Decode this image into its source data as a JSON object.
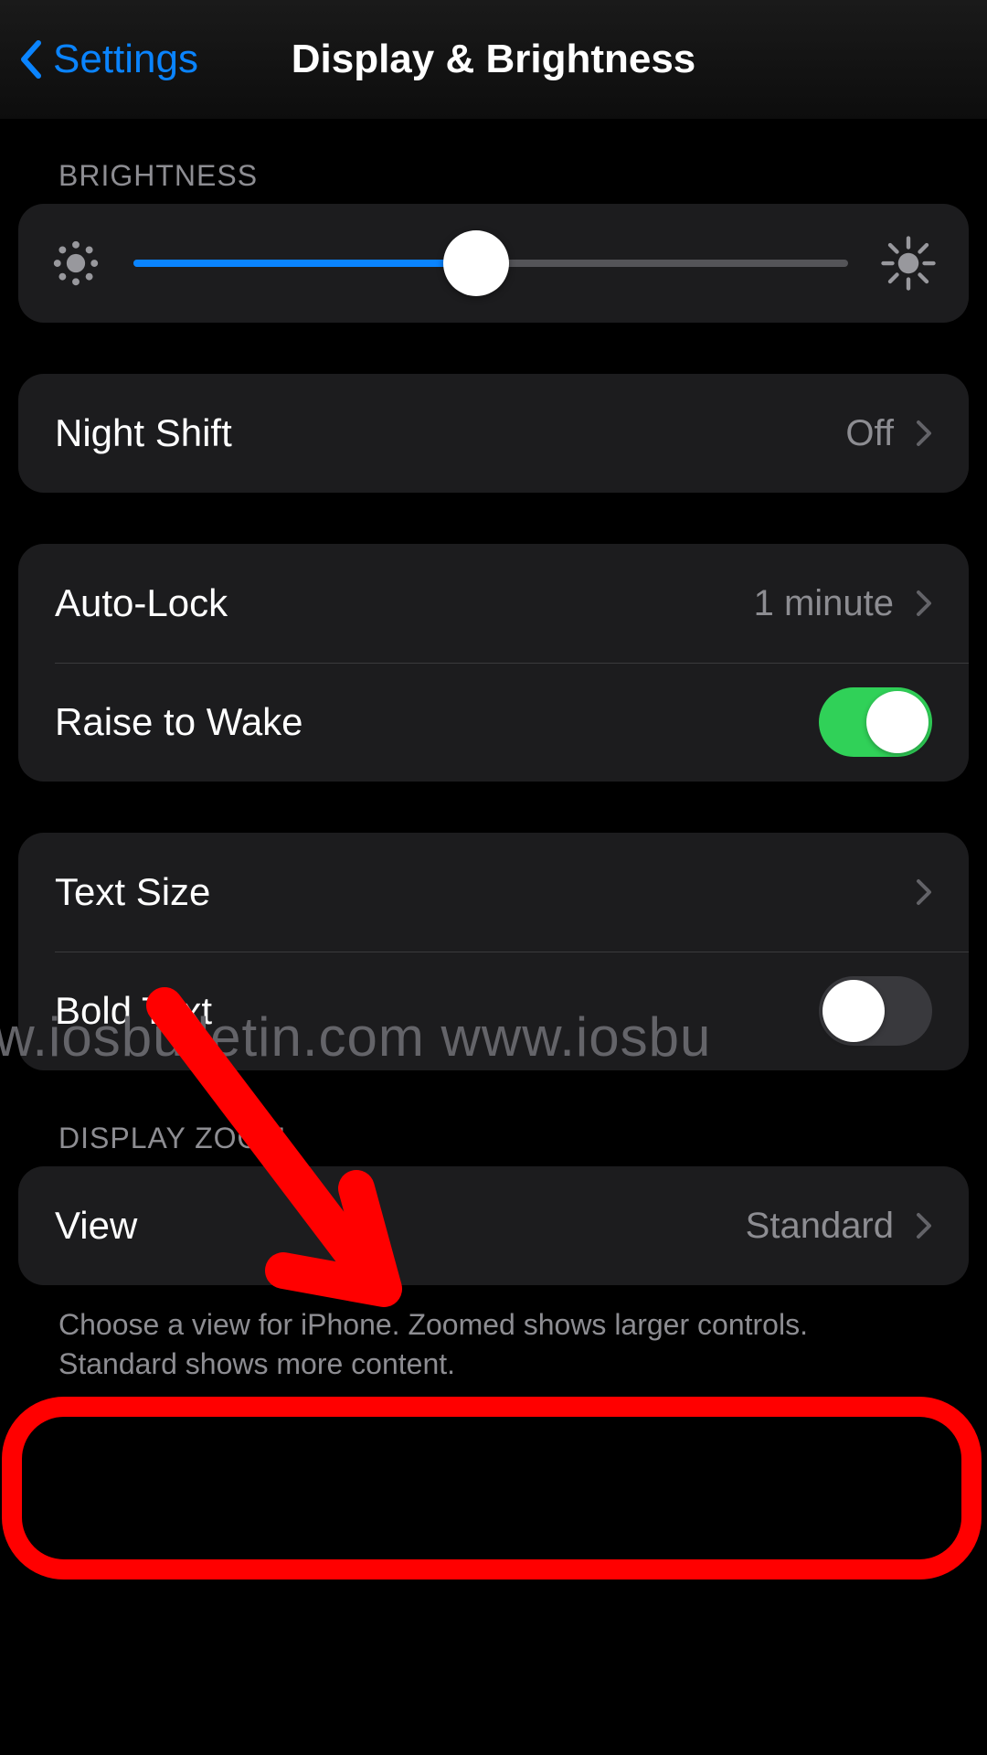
{
  "nav": {
    "back": "Settings",
    "title": "Display & Brightness"
  },
  "brightness": {
    "header": "BRIGHTNESS",
    "value_pct": 48
  },
  "night_shift": {
    "label": "Night Shift",
    "value": "Off"
  },
  "auto_lock": {
    "label": "Auto-Lock",
    "value": "1 minute"
  },
  "raise_to_wake": {
    "label": "Raise to Wake",
    "on": true
  },
  "text_size": {
    "label": "Text Size"
  },
  "bold_text": {
    "label": "Bold Text",
    "on": false
  },
  "display_zoom": {
    "header": "DISPLAY ZOOM",
    "label": "View",
    "value": "Standard",
    "footer": "Choose a view for iPhone. Zoomed shows larger controls. Standard shows more content."
  },
  "watermark": "ww.iosbulletin.com   www.iosbu"
}
